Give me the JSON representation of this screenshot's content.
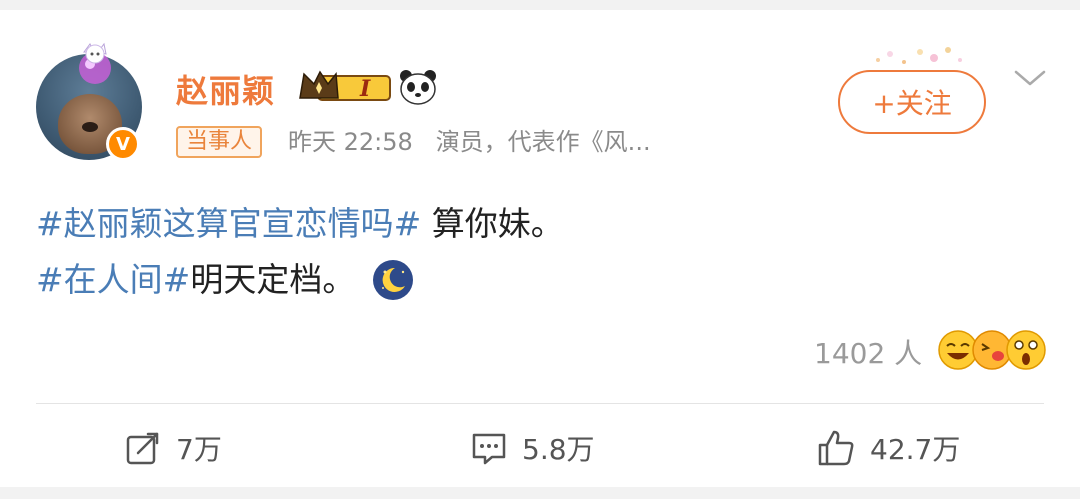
{
  "user": {
    "name": "赵丽颖",
    "level_badge": "I",
    "verified_mark": "V"
  },
  "meta": {
    "tag": "当事人",
    "time": "昨天 22:58",
    "description": "演员，代表作《风..."
  },
  "follow_button": {
    "label": "+关注"
  },
  "post": {
    "line1_hashtag": "#赵丽颖这算官宣恋情吗#",
    "line1_text": " 算你妹。",
    "line2_hashtag": "#在人间#",
    "line2_text": "明天定档。",
    "emoji": "moon-sleep-icon"
  },
  "reactions": {
    "count_text": "1402 人",
    "icons": [
      "laugh-emoji-icon",
      "kiss-emoji-icon",
      "surprised-emoji-icon"
    ]
  },
  "actions": {
    "repost": "7万",
    "comment": "5.8万",
    "like": "42.7万"
  },
  "colors": {
    "accent": "#ee7a3c",
    "hashtag": "#4a7db6",
    "meta": "#8a8a8a",
    "background": "#f2f2f2"
  }
}
